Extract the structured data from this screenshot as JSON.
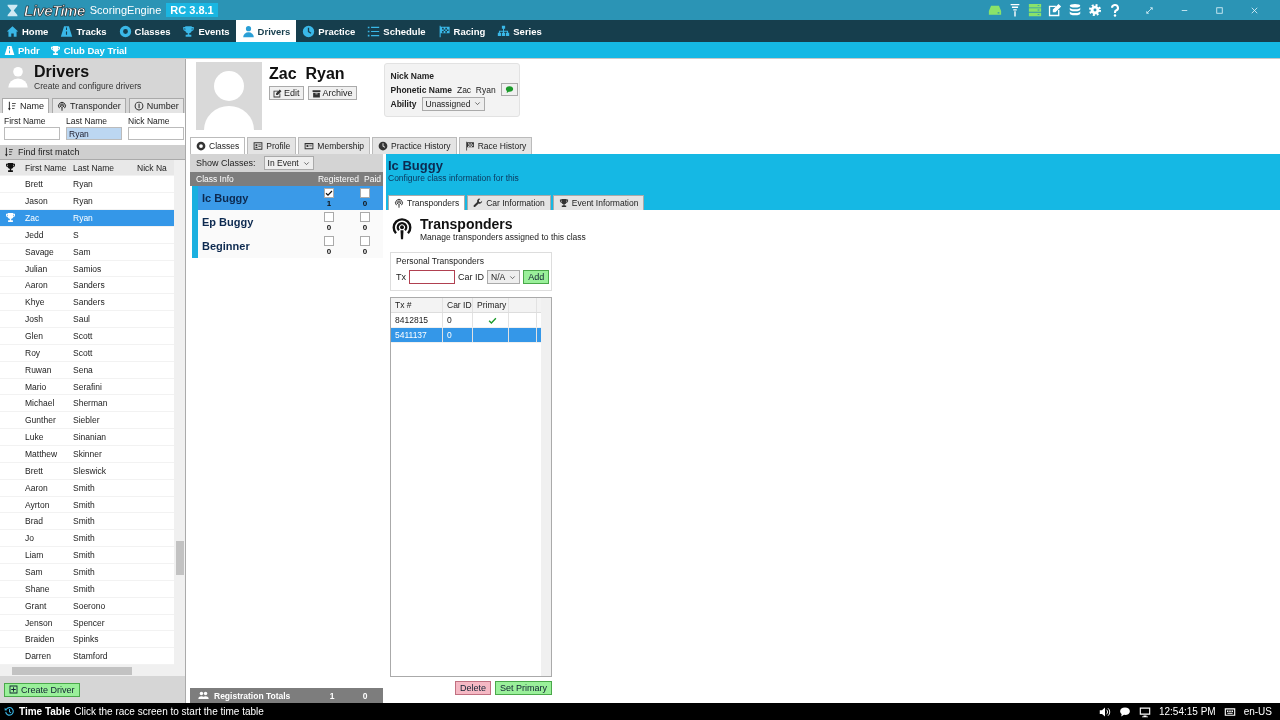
{
  "app": {
    "logo": "LiveTime",
    "product": "ScoringEngine",
    "version": "RC 3.8.1"
  },
  "nav": [
    {
      "label": "Home",
      "selected": false
    },
    {
      "label": "Tracks",
      "selected": false
    },
    {
      "label": "Classes",
      "selected": false
    },
    {
      "label": "Events",
      "selected": false
    },
    {
      "label": "Drivers",
      "selected": true
    },
    {
      "label": "Practice",
      "selected": false
    },
    {
      "label": "Schedule",
      "selected": false
    },
    {
      "label": "Racing",
      "selected": false
    },
    {
      "label": "Series",
      "selected": false
    }
  ],
  "breadcrumb": [
    "Phdr",
    "Club Day Trial"
  ],
  "drivers_panel": {
    "title": "Drivers",
    "subtitle": "Create and configure drivers",
    "search_tabs": [
      {
        "label": "Name",
        "selected": true
      },
      {
        "label": "Transponder",
        "selected": false
      },
      {
        "label": "Number",
        "selected": false
      }
    ],
    "filters": [
      {
        "label": "First Name"
      },
      {
        "label": "Last Name",
        "value": "Ryan"
      },
      {
        "label": "Nick Name"
      }
    ],
    "find_label": "Find first match",
    "columns": [
      "First Name",
      "Last Name",
      "Nick Na"
    ],
    "rows": [
      {
        "first": "Brett",
        "last": "Ryan",
        "selected": false,
        "trophy": false
      },
      {
        "first": "Jason",
        "last": "Ryan",
        "selected": false,
        "trophy": false
      },
      {
        "first": "Zac",
        "last": "Ryan",
        "selected": true,
        "trophy": true
      },
      {
        "first": "Jedd",
        "last": "S",
        "selected": false,
        "trophy": false
      },
      {
        "first": "Savage",
        "last": "Sam",
        "selected": false,
        "trophy": false
      },
      {
        "first": "Julian",
        "last": "Samios",
        "selected": false,
        "trophy": false
      },
      {
        "first": "Aaron",
        "last": "Sanders",
        "selected": false,
        "trophy": false
      },
      {
        "first": "Khye",
        "last": "Sanders",
        "selected": false,
        "trophy": false
      },
      {
        "first": "Josh",
        "last": "Saul",
        "selected": false,
        "trophy": false
      },
      {
        "first": "Glen",
        "last": "Scott",
        "selected": false,
        "trophy": false
      },
      {
        "first": "Roy",
        "last": "Scott",
        "selected": false,
        "trophy": false
      },
      {
        "first": "Ruwan",
        "last": "Sena",
        "selected": false,
        "trophy": false
      },
      {
        "first": "Mario",
        "last": "Serafini",
        "selected": false,
        "trophy": false
      },
      {
        "first": "Michael",
        "last": "Sherman",
        "selected": false,
        "trophy": false
      },
      {
        "first": "Gunther",
        "last": "Siebler",
        "selected": false,
        "trophy": false
      },
      {
        "first": "Luke",
        "last": "Sinanian",
        "selected": false,
        "trophy": false
      },
      {
        "first": "Matthew",
        "last": "Skinner",
        "selected": false,
        "trophy": false
      },
      {
        "first": "Brett",
        "last": "Sleswick",
        "selected": false,
        "trophy": false
      },
      {
        "first": "Aaron",
        "last": "Smith",
        "selected": false,
        "trophy": false
      },
      {
        "first": "Ayrton",
        "last": "Smith",
        "selected": false,
        "trophy": false
      },
      {
        "first": "Brad",
        "last": "Smith",
        "selected": false,
        "trophy": false
      },
      {
        "first": "Jo",
        "last": "Smith",
        "selected": false,
        "trophy": false
      },
      {
        "first": "Liam",
        "last": "Smith",
        "selected": false,
        "trophy": false
      },
      {
        "first": "Sam",
        "last": "Smith",
        "selected": false,
        "trophy": false
      },
      {
        "first": "Shane",
        "last": "Smith",
        "selected": false,
        "trophy": false
      },
      {
        "first": "Grant",
        "last": "Soerono",
        "selected": false,
        "trophy": false
      },
      {
        "first": "Jenson",
        "last": "Spencer",
        "selected": false,
        "trophy": false
      },
      {
        "first": "Braiden",
        "last": "Spinks",
        "selected": false,
        "trophy": false
      },
      {
        "first": "Darren",
        "last": "Stamford",
        "selected": false,
        "trophy": false
      }
    ],
    "create_button": "Create Driver"
  },
  "driver": {
    "name": "Zac  Ryan",
    "actions": [
      "Edit",
      "Archive"
    ],
    "nick_label": "Nick Name",
    "phonetic_label": "Phonetic Name",
    "phonetic_value": "Zac  Ryan",
    "ability_label": "Ability",
    "ability_value": "Unassigned",
    "tabs": [
      {
        "label": "Classes",
        "selected": true
      },
      {
        "label": "Profile",
        "selected": false
      },
      {
        "label": "Membership",
        "selected": false
      },
      {
        "label": "Practice History",
        "selected": false
      },
      {
        "label": "Race History",
        "selected": false
      }
    ]
  },
  "classes": {
    "show_label": "Show Classes:",
    "show_value": "In Event",
    "columns": [
      "Class Info",
      "Registered",
      "Paid"
    ],
    "rows": [
      {
        "name": "Ic Buggy",
        "selected": true,
        "registered": true,
        "registered_count": "1",
        "paid": false,
        "paid_count": "0"
      },
      {
        "name": "Ep Buggy",
        "selected": false,
        "registered": false,
        "registered_count": "0",
        "paid": false,
        "paid_count": "0"
      },
      {
        "name": "Beginner",
        "selected": false,
        "registered": false,
        "registered_count": "0",
        "paid": false,
        "paid_count": "0"
      }
    ],
    "totals_label": "Registration Totals",
    "totals_registered": "1",
    "totals_paid": "0"
  },
  "class_detail": {
    "title": "Ic Buggy",
    "subtitle": "Configure class information for this",
    "tabs": [
      {
        "label": "Transponders",
        "selected": true
      },
      {
        "label": "Car Information",
        "selected": false
      },
      {
        "label": "Event Information",
        "selected": false
      }
    ],
    "section_title": "Transponders",
    "section_subtitle": "Manage transponders assigned to this class",
    "group_label": "Personal Transponders",
    "tx_label": "Tx",
    "car_id_label": "Car ID",
    "car_id_value": "N/A",
    "add_button": "Add",
    "columns": [
      "Tx #",
      "Car ID",
      "Primary"
    ],
    "rows": [
      {
        "tx": "8412815",
        "car_id": "0",
        "primary": true,
        "selected": false
      },
      {
        "tx": "5411137",
        "car_id": "0",
        "primary": false,
        "selected": true
      }
    ],
    "buttons": [
      {
        "label": "Delete",
        "kind": "danger"
      },
      {
        "label": "Set Primary",
        "kind": "ok"
      }
    ]
  },
  "status": {
    "title": "Time Table",
    "message": "Click the race screen to start the time table",
    "time": "12:54:15 PM",
    "locale": "en-US"
  }
}
